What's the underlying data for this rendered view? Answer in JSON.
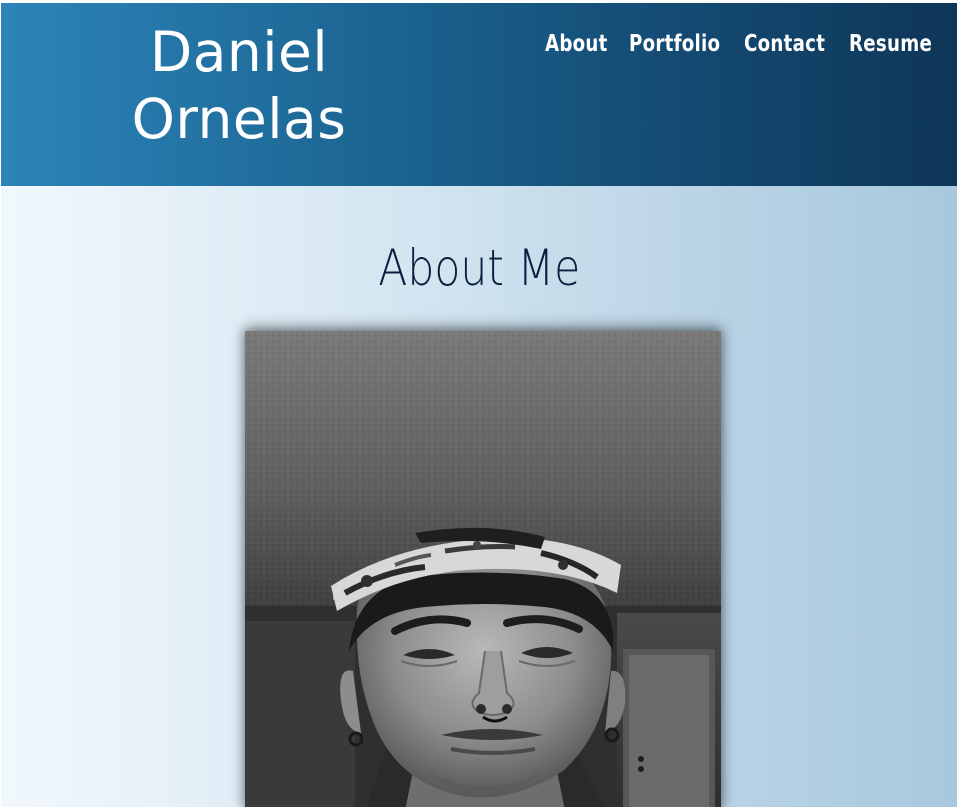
{
  "header": {
    "brand_line1": "Daniel",
    "brand_line2": "Ornelas",
    "nav": {
      "about": "About",
      "portfolio": "Portfolio",
      "contact": "Contact",
      "resume": "Resume"
    }
  },
  "main": {
    "section_title": "About Me",
    "photo": {
      "alt": "Black and white selfie of Daniel Ornelas wearing a backwards cap"
    }
  },
  "colors": {
    "header_gradient_start": "#2c84b9",
    "header_gradient_end": "#0e3658",
    "body_gradient_start": "#f1f8fd",
    "body_gradient_end": "#a8c8de",
    "title_color": "#0b1e3f",
    "nav_text": "#ffffff"
  }
}
